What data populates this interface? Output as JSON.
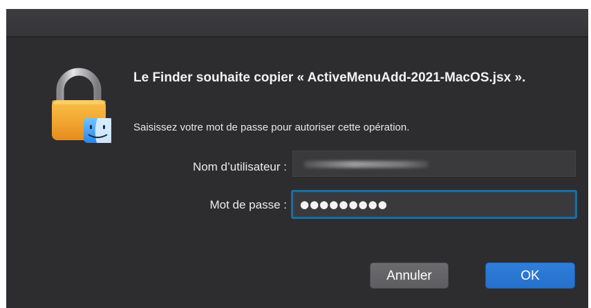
{
  "dialog": {
    "title": "Le Finder souhaite copier « ActiveMenuAdd-2021-MacOS.jsx ».",
    "subtitle": "Saisissez votre mot de passe pour autoriser cette opération.",
    "icon": "lock-with-finder-icon"
  },
  "form": {
    "username_label": "Nom d’utilisateur :",
    "username_value": "",
    "password_label": "Mot de passe :",
    "password_value": "●●●●●●●●●"
  },
  "buttons": {
    "cancel_label": "Annuler",
    "ok_label": "OK"
  },
  "colors": {
    "dialog_background": "#2d2d2f",
    "accent_focus": "#1f6c9c",
    "ok_button": "#2a78d4",
    "cancel_button": "#646467"
  }
}
